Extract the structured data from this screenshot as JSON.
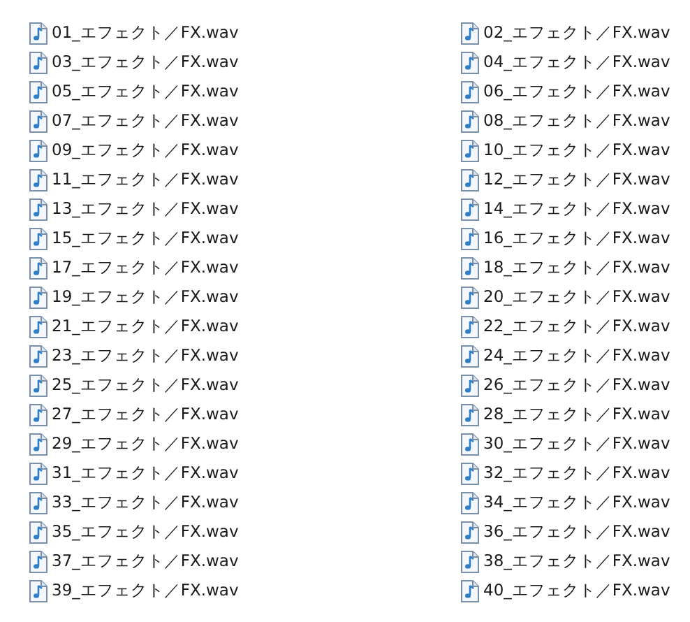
{
  "files": [
    {
      "name": "01_エフェクト／FX.wav"
    },
    {
      "name": "02_エフェクト／FX.wav"
    },
    {
      "name": "03_エフェクト／FX.wav"
    },
    {
      "name": "04_エフェクト／FX.wav"
    },
    {
      "name": "05_エフェクト／FX.wav"
    },
    {
      "name": "06_エフェクト／FX.wav"
    },
    {
      "name": "07_エフェクト／FX.wav"
    },
    {
      "name": "08_エフェクト／FX.wav"
    },
    {
      "name": "09_エフェクト／FX.wav"
    },
    {
      "name": "10_エフェクト／FX.wav"
    },
    {
      "name": "11_エフェクト／FX.wav"
    },
    {
      "name": "12_エフェクト／FX.wav"
    },
    {
      "name": "13_エフェクト／FX.wav"
    },
    {
      "name": "14_エフェクト／FX.wav"
    },
    {
      "name": "15_エフェクト／FX.wav"
    },
    {
      "name": "16_エフェクト／FX.wav"
    },
    {
      "name": "17_エフェクト／FX.wav"
    },
    {
      "name": "18_エフェクト／FX.wav"
    },
    {
      "name": "19_エフェクト／FX.wav"
    },
    {
      "name": "20_エフェクト／FX.wav"
    },
    {
      "name": "21_エフェクト／FX.wav"
    },
    {
      "name": "22_エフェクト／FX.wav"
    },
    {
      "name": "23_エフェクト／FX.wav"
    },
    {
      "name": "24_エフェクト／FX.wav"
    },
    {
      "name": "25_エフェクト／FX.wav"
    },
    {
      "name": "26_エフェクト／FX.wav"
    },
    {
      "name": "27_エフェクト／FX.wav"
    },
    {
      "name": "28_エフェクト／FX.wav"
    },
    {
      "name": "29_エフェクト／FX.wav"
    },
    {
      "name": "30_エフェクト／FX.wav"
    },
    {
      "name": "31_エフェクト／FX.wav"
    },
    {
      "name": "32_エフェクト／FX.wav"
    },
    {
      "name": "33_エフェクト／FX.wav"
    },
    {
      "name": "34_エフェクト／FX.wav"
    },
    {
      "name": "35_エフェクト／FX.wav"
    },
    {
      "name": "36_エフェクト／FX.wav"
    },
    {
      "name": "37_エフェクト／FX.wav"
    },
    {
      "name": "38_エフェクト／FX.wav"
    },
    {
      "name": "39_エフェクト／FX.wav"
    },
    {
      "name": "40_エフェクト／FX.wav"
    }
  ]
}
